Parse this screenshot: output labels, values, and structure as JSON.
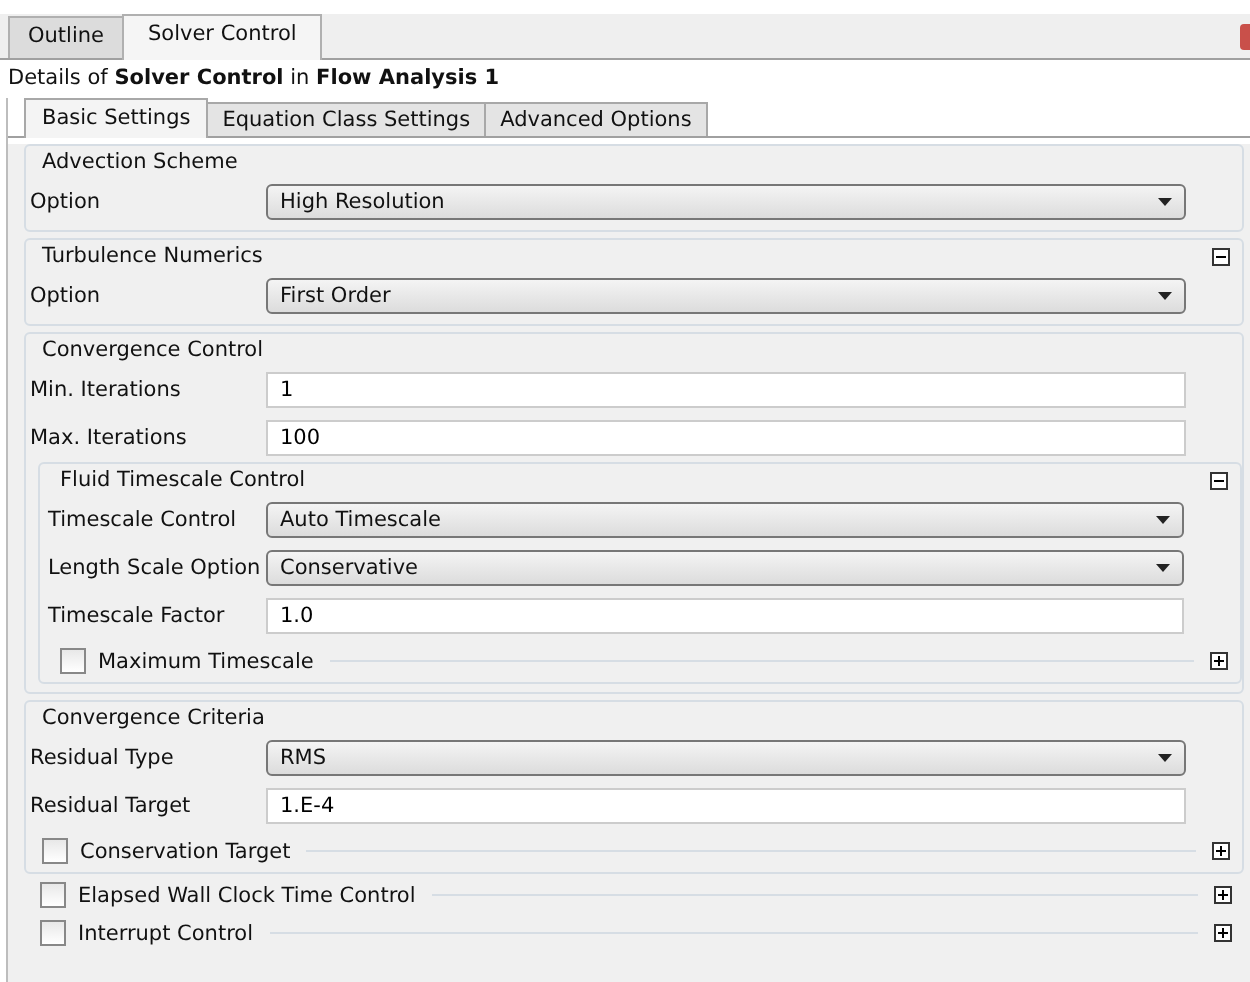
{
  "outer_tabs": [
    {
      "label": "Outline",
      "selected": false
    },
    {
      "label": "Solver Control",
      "selected": true
    }
  ],
  "details_title": "Details of **Solver Control** in **Flow Analysis 1**",
  "tabs": [
    {
      "label": "Basic Settings",
      "selected": true
    },
    {
      "label": "Equation Class Settings",
      "selected": false
    },
    {
      "label": "Advanced Options",
      "selected": false
    }
  ],
  "sections": [
    {
      "kind": "group",
      "title": "Advection Scheme",
      "rows": [
        {
          "kind": "dropdown",
          "label": "Option",
          "value": "High Resolution"
        }
      ]
    },
    {
      "kind": "collapsible",
      "title": "Turbulence Numerics",
      "expanded": true,
      "rows": [
        {
          "kind": "dropdown",
          "label": "Option",
          "value": "First Order"
        }
      ]
    },
    {
      "kind": "group",
      "title": "Convergence Control",
      "rows": [
        {
          "kind": "text",
          "label": "Min. Iterations",
          "value": "1"
        },
        {
          "kind": "text",
          "label": "Max. Iterations",
          "value": "100"
        }
      ],
      "children": [
        {
          "kind": "collapsible",
          "title": "Fluid Timescale Control",
          "expanded": true,
          "rows": [
            {
              "kind": "dropdown",
              "label": "Timescale Control",
              "value": "Auto Timescale"
            },
            {
              "kind": "dropdown",
              "label": "Length Scale Option",
              "value": "Conservative"
            },
            {
              "kind": "text",
              "label": "Timescale Factor",
              "value": "1.0"
            }
          ],
          "children": [
            {
              "kind": "checkbox",
              "title": "Maximum Timescale",
              "checked": false,
              "expanded": false
            }
          ]
        }
      ]
    },
    {
      "kind": "group",
      "title": "Convergence Criteria",
      "rows": [
        {
          "kind": "dropdown",
          "label": "Residual Type",
          "value": "RMS"
        },
        {
          "kind": "text",
          "label": "Residual Target",
          "value": "1.E-4"
        }
      ],
      "children": [
        {
          "kind": "checkbox",
          "title": "Conservation Target",
          "checked": false,
          "expanded": false
        }
      ]
    },
    {
      "kind": "checkbox",
      "title": "Elapsed Wall Clock Time Control",
      "checked": false,
      "expanded": false
    },
    {
      "kind": "checkbox",
      "title": "Interrupt Control",
      "checked": false,
      "expanded": false
    }
  ]
}
